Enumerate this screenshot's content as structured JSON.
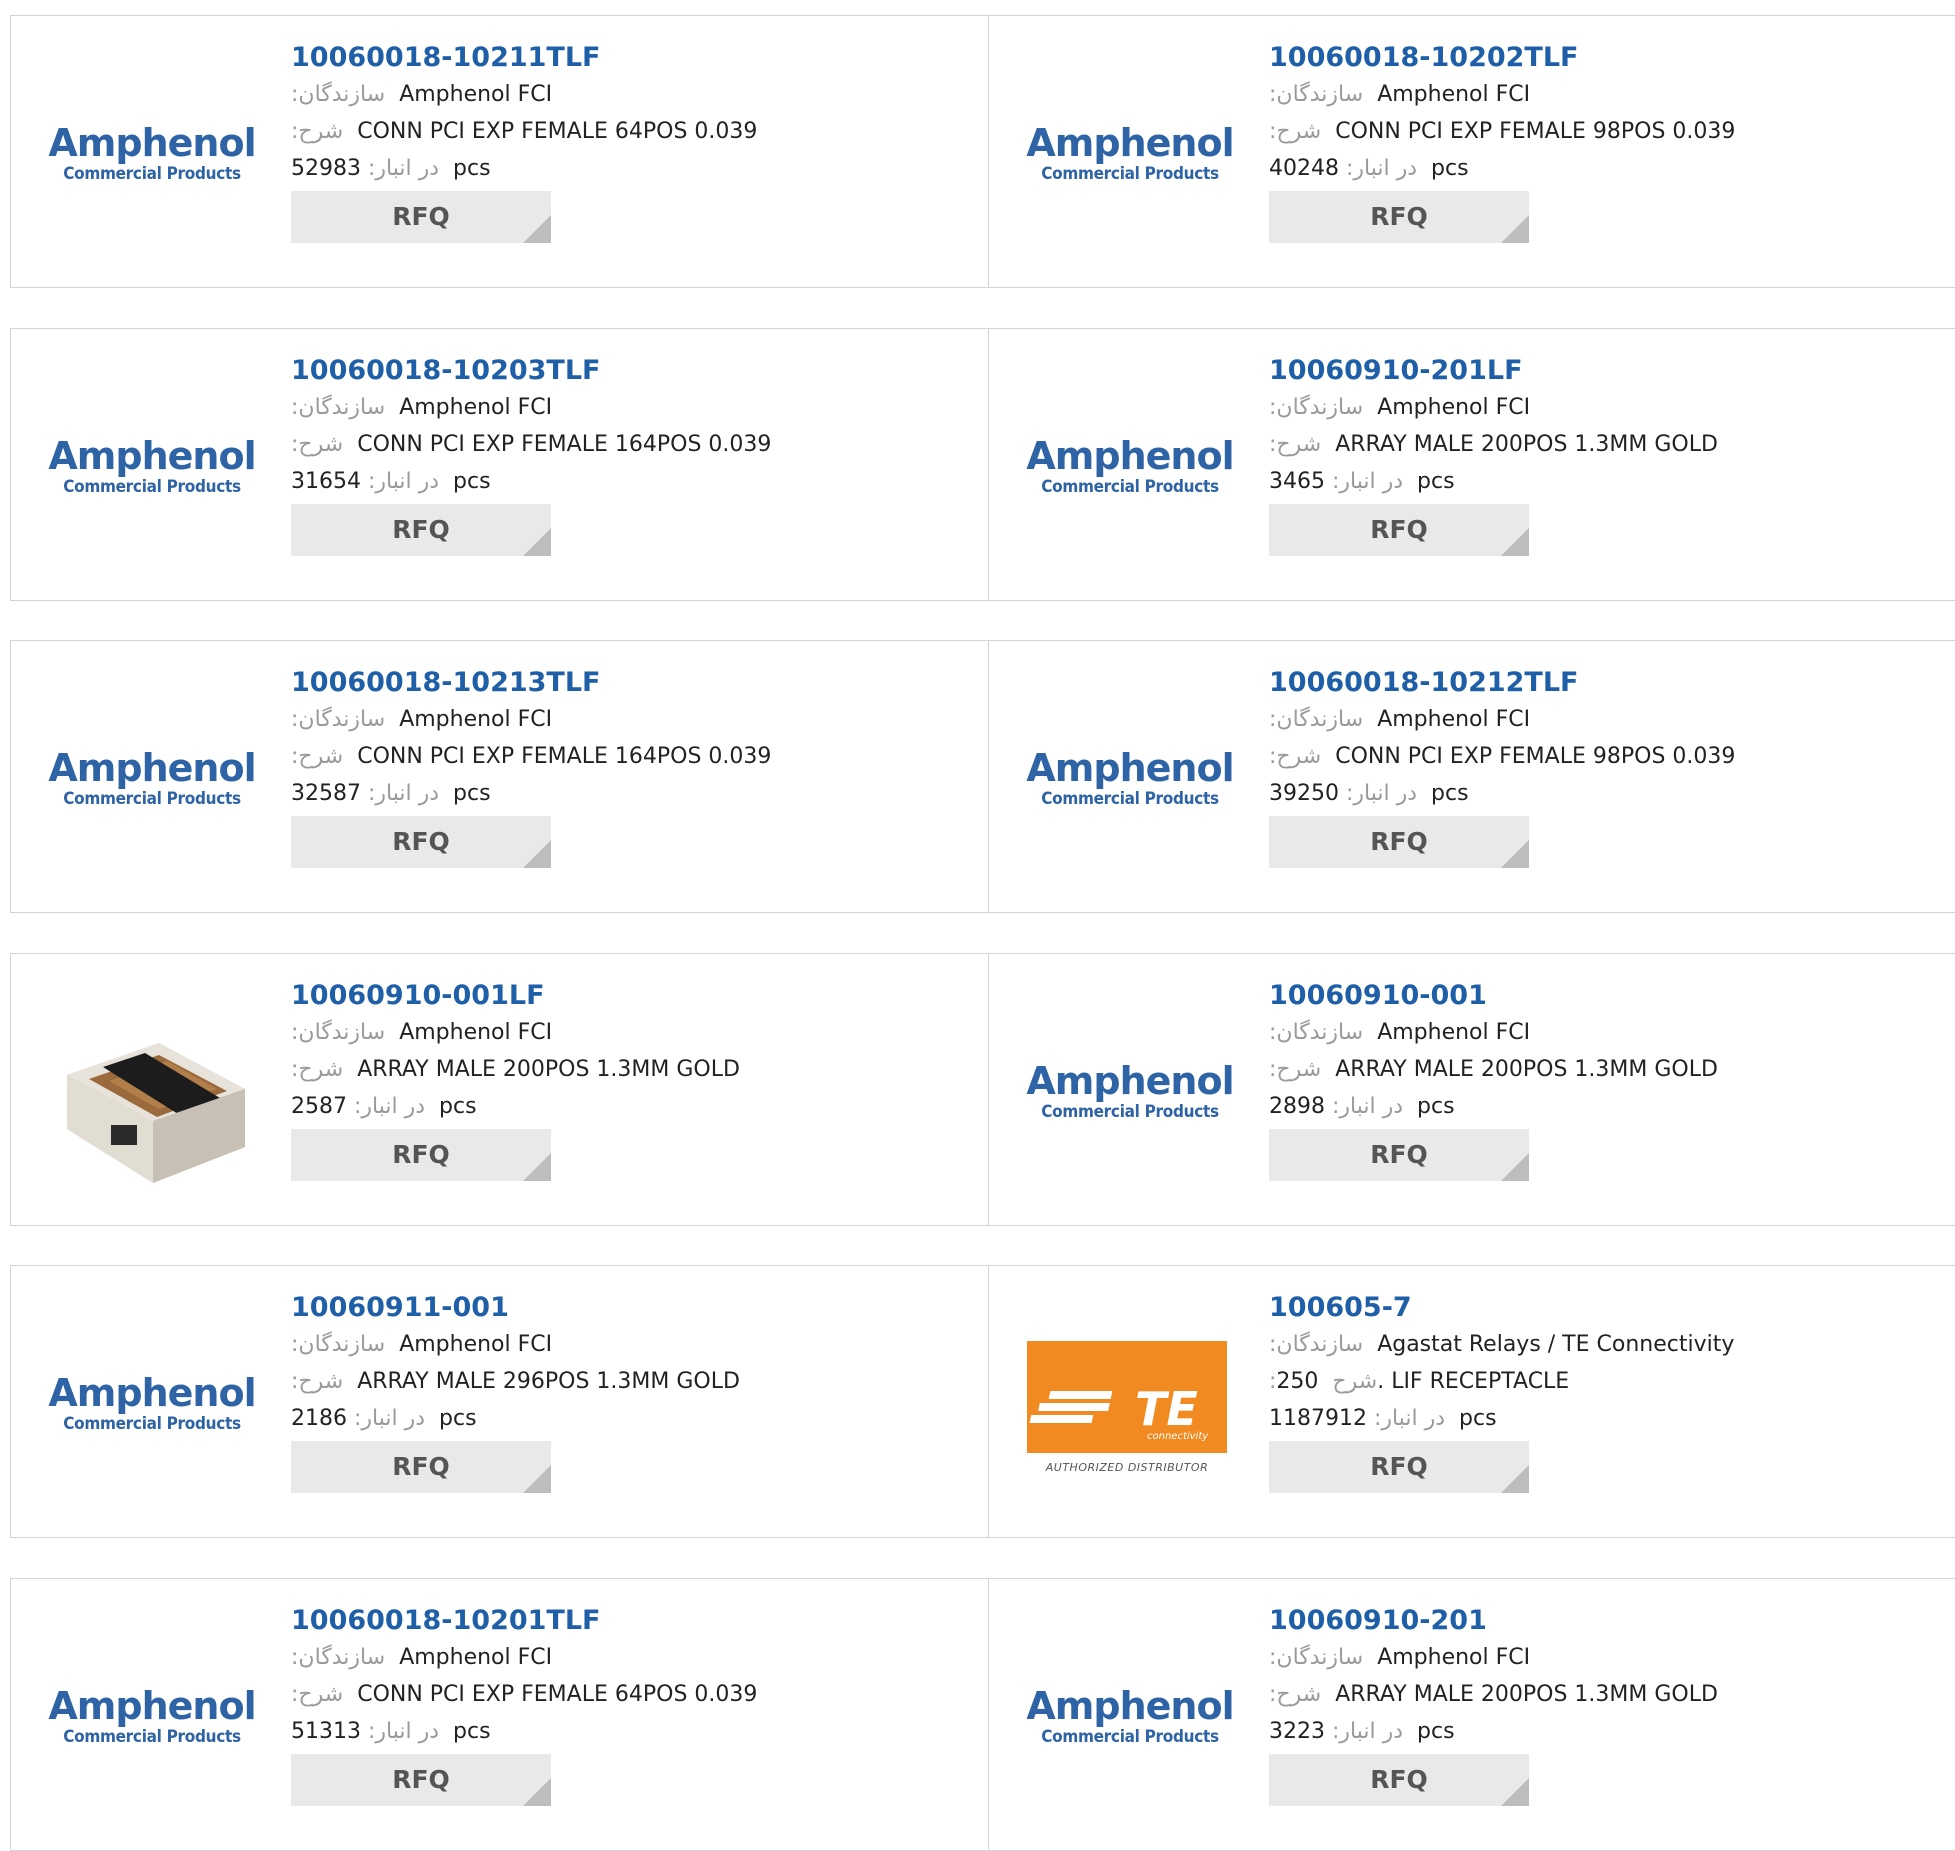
{
  "labels": {
    "manufacturer": "سازندگان",
    "description": "شرح",
    "stock": "در انبار",
    "unit": "pcs",
    "rfq": "RFQ"
  },
  "logos": {
    "amphenol_brand": "Amphenol",
    "amphenol_sub": "Commercial Products",
    "te_brand": "TE",
    "te_sub": "connectivity",
    "te_authorized": "AUTHORIZED DISTRIBUTOR"
  },
  "colors": {
    "part_link": "#1e5fa8",
    "amphenol_blue": "#2e63a6",
    "te_orange": "#f18b21",
    "rfq_bg": "#e9e9e9"
  },
  "products": [
    {
      "part": "10060018-10211TLF",
      "manufacturer": "Amphenol FCI",
      "description": "CONN PCI EXP FEMALE 64POS 0.039",
      "stock": "52983",
      "image": "amphenol-logo"
    },
    {
      "part": "10060018-10202TLF",
      "manufacturer": "Amphenol FCI",
      "description": "CONN PCI EXP FEMALE 98POS 0.039",
      "stock": "40248",
      "image": "amphenol-logo"
    },
    {
      "part": "10060018-10203TLF",
      "manufacturer": "Amphenol FCI",
      "description": "CONN PCI EXP FEMALE 164POS 0.039",
      "stock": "31654",
      "image": "amphenol-logo"
    },
    {
      "part": "10060910-201LF",
      "manufacturer": "Amphenol FCI",
      "description": "ARRAY MALE 200POS 1.3MM GOLD",
      "stock": "3465",
      "image": "amphenol-logo"
    },
    {
      "part": "10060018-10213TLF",
      "manufacturer": "Amphenol FCI",
      "description": "CONN PCI EXP FEMALE 164POS 0.039",
      "stock": "32587",
      "image": "amphenol-logo"
    },
    {
      "part": "10060018-10212TLF",
      "manufacturer": "Amphenol FCI",
      "description": "CONN PCI EXP FEMALE 98POS 0.039",
      "stock": "39250",
      "image": "amphenol-logo"
    },
    {
      "part": "10060910-001LF",
      "manufacturer": "Amphenol FCI",
      "description": "ARRAY MALE 200POS 1.3MM GOLD",
      "stock": "2587",
      "image": "connector-photo"
    },
    {
      "part": "10060910-001",
      "manufacturer": "Amphenol FCI",
      "description": "ARRAY MALE 200POS 1.3MM GOLD",
      "stock": "2898",
      "image": "amphenol-logo"
    },
    {
      "part": "10060911-001",
      "manufacturer": "Amphenol FCI",
      "description": "ARRAY MALE 296POS 1.3MM GOLD",
      "stock": "2186",
      "image": "amphenol-logo"
    },
    {
      "part": "100605-7",
      "manufacturer": "Agastat Relays / TE Connectivity",
      "description": "250. LIF RECEPTACLE",
      "stock": "1187912",
      "image": "te-logo"
    },
    {
      "part": "10060018-10201TLF",
      "manufacturer": "Amphenol FCI",
      "description": "CONN PCI EXP FEMALE 64POS 0.039",
      "stock": "51313",
      "image": "amphenol-logo"
    },
    {
      "part": "10060910-201",
      "manufacturer": "Amphenol FCI",
      "description": "ARRAY MALE 200POS 1.3MM GOLD",
      "stock": "3223",
      "image": "amphenol-logo"
    }
  ]
}
